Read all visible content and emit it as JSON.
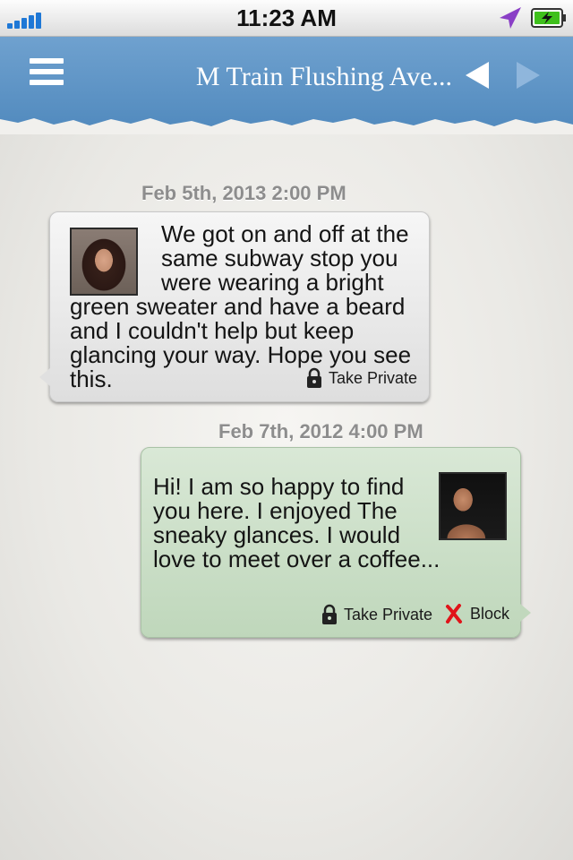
{
  "status_bar": {
    "time": "11:23 AM"
  },
  "nav": {
    "title": "M Train Flushing Ave..."
  },
  "thread": {
    "messages": [
      {
        "timestamp": "Feb 5th, 2013 2:00 PM",
        "text": "We got on and off at the same subway stop you were wearing a bright green sweater and have a beard and I couldn't help but keep glancing your way. Hope you see this.",
        "actions": {
          "take_private": "Take Private"
        }
      },
      {
        "timestamp": "Feb 7th, 2012 4:00 PM",
        "text": "Hi! I am so happy to find you here. I enjoyed The sneaky glances. I would love to meet over a coffee...",
        "actions": {
          "take_private": "Take Private",
          "block": "Block"
        }
      }
    ]
  },
  "colors": {
    "nav_blue": "#5b93c6",
    "incoming_bubble": "#e6e6e6",
    "outgoing_bubble": "#c8dfc4",
    "timestamp_gray": "#8d8d8d",
    "signal_blue": "#1f78d6",
    "location_purple": "#8a3fc6",
    "battery_green": "#3fc01c",
    "block_red": "#e0141a"
  },
  "icons": {
    "signal": "signal-bars-icon",
    "location": "location-arrow-icon",
    "battery": "battery-charging-icon",
    "menu": "hamburger-menu-icon",
    "prev": "triangle-left-icon",
    "next": "triangle-right-icon",
    "lock": "lock-icon",
    "block": "red-x-icon"
  }
}
